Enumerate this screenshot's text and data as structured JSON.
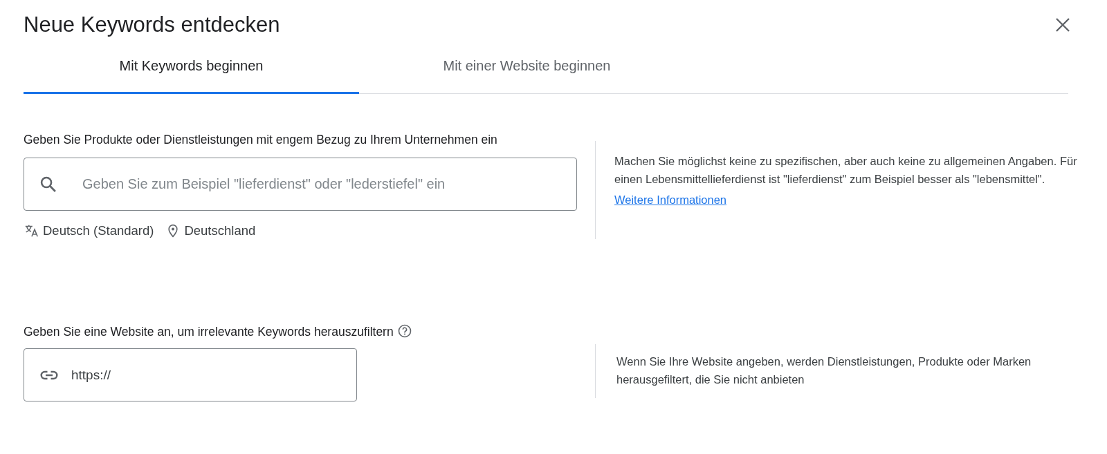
{
  "dialog": {
    "title": "Neue Keywords entdecken"
  },
  "tabs": [
    {
      "label": "Mit Keywords beginnen",
      "selected": true
    },
    {
      "label": "Mit einer Website beginnen",
      "selected": false
    }
  ],
  "sections": [
    {
      "kind": "keywords",
      "label": "Geben Sie Produkte oder Dienstleistungen mit engem Bezug zu Ihrem Unternehmen ein",
      "help": false,
      "field": {
        "placeholder": "Geben Sie zum Beispiel \"lieferdienst\" oder \"lederstiefel\" ein"
      },
      "language": "Deutsch (Standard)",
      "location": "Deutschland",
      "hint": {
        "text": "Machen Sie möglichst keine zu spezifischen, aber auch keine zu allgemeinen Angaben. Für einen Lebensmittellieferdienst ist \"lieferdienst\" zum Beispiel besser als \"lebensmittel\".",
        "link": "Weitere Informationen"
      }
    },
    {
      "kind": "website",
      "label": "Geben Sie eine Website an, um irrelevante Keywords herauszufiltern",
      "help": true,
      "field": {
        "value": "https://"
      },
      "hint": {
        "text": "Wenn Sie Ihre Website angeben, werden Dienstleistungen, Produkte oder Marken herausgefiltert, die Sie nicht anbieten"
      }
    }
  ]
}
